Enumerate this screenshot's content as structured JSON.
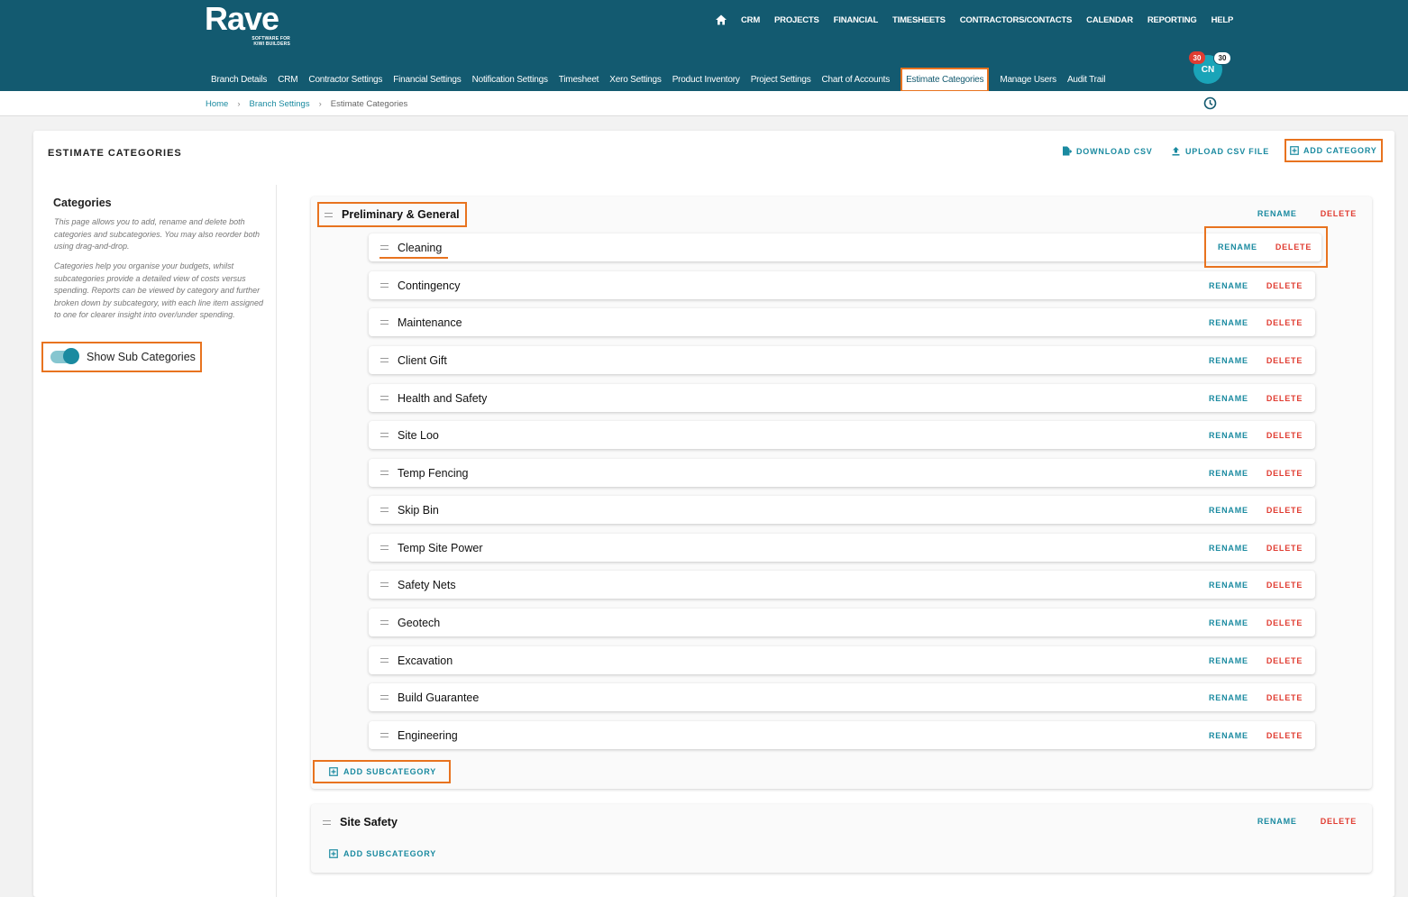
{
  "brand": {
    "name": "Rave",
    "tagline_line1": "SOFTWARE FOR",
    "tagline_line2": "KIWI BUILDERS"
  },
  "top_nav": [
    "CRM",
    "PROJECTS",
    "FINANCIAL",
    "TIMESHEETS",
    "CONTRACTORS/CONTACTS",
    "CALENDAR",
    "REPORTING",
    "HELP"
  ],
  "sub_nav": [
    "Branch Details",
    "CRM",
    "Contractor Settings",
    "Financial Settings",
    "Notification Settings",
    "Timesheet",
    "Xero Settings",
    "Product Inventory",
    "Project Settings",
    "Chart of Accounts",
    "Estimate Categories",
    "Manage Users",
    "Audit Trail"
  ],
  "user": {
    "initials": "CN",
    "badge_count_red": "30",
    "badge_count_white": "30"
  },
  "breadcrumb": {
    "home": "Home",
    "branch_settings": "Branch Settings",
    "current": "Estimate Categories"
  },
  "page": {
    "title": "ESTIMATE CATEGORIES",
    "download_csv": "DOWNLOAD CSV",
    "upload_csv": "UPLOAD CSV FILE",
    "add_category": "ADD CATEGORY"
  },
  "left_panel": {
    "title": "Categories",
    "desc1": "This page allows you to add, rename and delete both categories and subcategories. You may also reorder both using drag-and-drop.",
    "desc2": "Categories help you organise your budgets, whilst subcategories provide a detailed view of costs versus spending. Reports can be viewed by category and further broken down by subcategory, with each line item assigned to one for clearer insight into over/under spending.",
    "toggle_label": "Show Sub Categories",
    "toggle_on": true
  },
  "labels": {
    "rename": "RENAME",
    "delete": "DELETE",
    "add_subcategory": "ADD SUBCATEGORY"
  },
  "categories": [
    {
      "name": "Preliminary & General",
      "subcategories": [
        "Cleaning",
        "Contingency",
        "Maintenance",
        "Client Gift",
        "Health and Safety",
        "Site Loo",
        "Temp Fencing",
        "Skip Bin",
        "Temp Site Power",
        "Safety Nets",
        "Geotech",
        "Excavation",
        "Build Guarantee",
        "Engineering"
      ]
    },
    {
      "name": "Site Safety",
      "subcategories": []
    }
  ],
  "colors": {
    "header": "#135a70",
    "accent": "#1a8aa0",
    "danger": "#e03c31",
    "highlight": "#e8731f"
  }
}
